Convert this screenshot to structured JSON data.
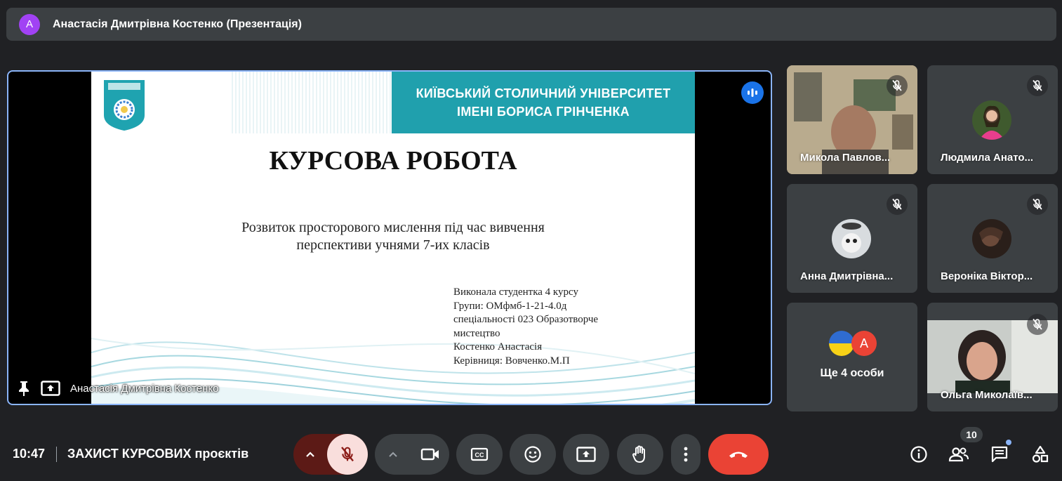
{
  "presentation": {
    "title": "Анастасія Дмитрівна Костенко (Презентація)",
    "avatar_letter": "А",
    "presenter_label": "Анастасія Дмитрівна Костенко"
  },
  "slide": {
    "university_line1": "КИЇВСЬКИЙ СТОЛИЧНИЙ УНІВЕРСИТЕТ",
    "university_line2": "ІМЕНІ БОРИСА ГРІНЧЕНКА",
    "title": "КУРСОВА РОБОТА",
    "subtitle_line1": "Розвиток просторового мислення під час вивчення",
    "subtitle_line2": "перспективи учнями 7-их класів",
    "info_lines": [
      "Виконала студентка 4  курсу",
      " Групи: ОМфмб-1-21-4.0д",
      " спеціальності 023 Образотворче",
      "мистецтво",
      "Костенко Анастасія",
      "Керівниця: Вовченко.М.П"
    ]
  },
  "participants": [
    {
      "name": "Микола Павлов...",
      "muted": true
    },
    {
      "name": "Людмила Анато...",
      "muted": true
    },
    {
      "name": "Анна Дмитрівна...",
      "muted": true
    },
    {
      "name": "Вероніка Віктор...",
      "muted": true
    },
    {
      "name": "Ще 4 особи",
      "avatar_letter": "А"
    },
    {
      "name": "Ольга Миколаїв...",
      "muted": true
    }
  ],
  "bottom": {
    "time": "10:47",
    "meeting_name": "ЗАХИСТ КУРСОВИХ проєктів",
    "participants_count": "10"
  },
  "colors": {
    "background": "#202124",
    "tile": "#3c4043",
    "accent_blue": "#8ab4f8",
    "teal": "#20a0ad",
    "end_call": "#ea4335",
    "mic_off_bg": "#f9dedc",
    "mic_off_icon": "#8c1d18"
  }
}
